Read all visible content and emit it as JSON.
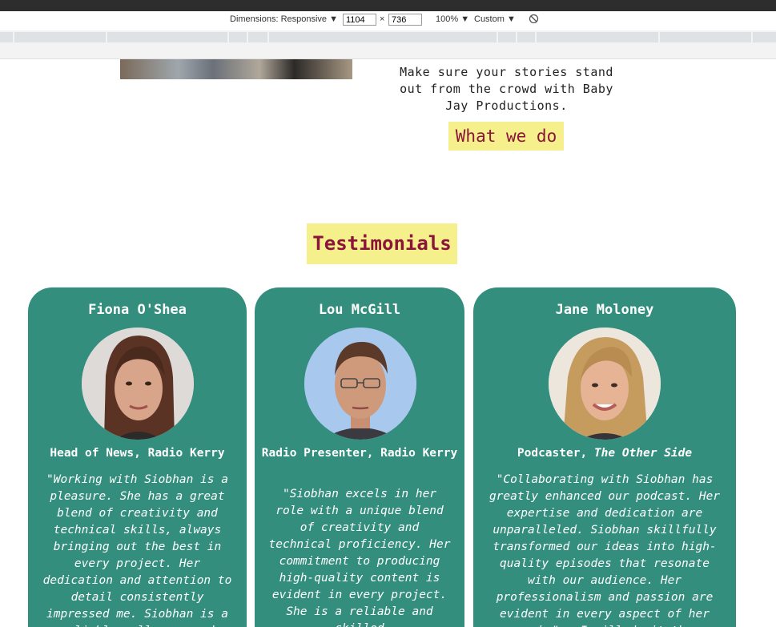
{
  "devtools": {
    "dimensions_label": "Dimensions: Responsive ▼",
    "width": "1104",
    "times": "×",
    "height": "736",
    "zoom": "100% ▼",
    "throttle": "Custom ▼"
  },
  "hero": {
    "line1": "Make sure your stories stand",
    "line2": "out from the crowd with Baby",
    "line3": "Jay Productions.",
    "cta": "What we do"
  },
  "testimonials": {
    "heading": "Testimonials",
    "items": [
      {
        "name": "Fiona O'Shea",
        "role": "Head of News, Radio Kerry",
        "quote": "\"Working with Siobhan is a pleasure. She has a great blend of creativity and technical skills, always bringing out the best in every project. Her dedication and attention to detail consistently impressed me. Siobhan is a reliable colleague and"
      },
      {
        "name": "Lou McGill",
        "role": "Radio Presenter, Radio Kerry",
        "quote": "\"Siobhan excels in her role with a unique blend of creativity and technical proficiency. Her commitment to producing high-quality content is evident in every project. She is a reliable and skilled"
      },
      {
        "name": "Jane Moloney",
        "role_prefix": "Podcaster, ",
        "role_show": "The Other Side",
        "quote": "\"Collaborating with Siobhan has greatly enhanced our podcast. Her expertise and dedication are unparalleled. Siobhan skillfully transformed our ideas into high-quality episodes that resonate with our audience. Her professionalism and passion are evident in every aspect of her work.\" — I will do it the"
      }
    ]
  },
  "colors": {
    "accent_yellow": "#f6f08c",
    "maroon": "#8a1538",
    "card_teal": "#338e7d"
  }
}
